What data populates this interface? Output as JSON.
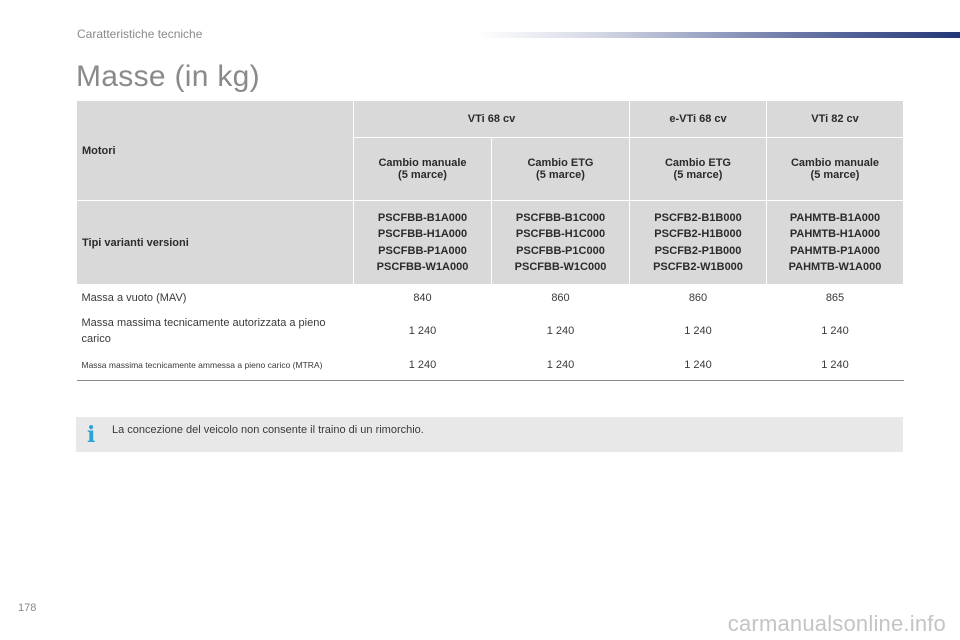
{
  "header": {
    "section": "Caratteristiche tecniche"
  },
  "title": "Masse (in kg)",
  "table": {
    "motori_label": "Motori",
    "engines": [
      "VTi 68 cv",
      "e-VTi 68 cv",
      "VTi 82 cv"
    ],
    "gearboxes": [
      [
        "Cambio manuale",
        "(5 marce)"
      ],
      [
        "Cambio ETG",
        "(5 marce)"
      ],
      [
        "Cambio ETG",
        "(5 marce)"
      ],
      [
        "Cambio manuale",
        "(5 marce)"
      ]
    ],
    "variants_label": "Tipi varianti versioni",
    "variants": [
      [
        "PSCFBB-B1A000",
        "PSCFBB-H1A000",
        "PSCFBB-P1A000",
        "PSCFBB-W1A000"
      ],
      [
        "PSCFBB-B1C000",
        "PSCFBB-H1C000",
        "PSCFBB-P1C000",
        "PSCFBB-W1C000"
      ],
      [
        "PSCFB2-B1B000",
        "PSCFB2-H1B000",
        "PSCFB2-P1B000",
        "PSCFB2-W1B000"
      ],
      [
        "PAHMTB-B1A000",
        "PAHMTB-H1A000",
        "PAHMTB-P1A000",
        "PAHMTB-W1A000"
      ]
    ],
    "rows": [
      {
        "label": "Massa a vuoto (MAV)",
        "values": [
          "840",
          "860",
          "860",
          "865"
        ]
      },
      {
        "label": "Massa massima tecnicamente autorizzata a pieno carico",
        "values": [
          "1 240",
          "1 240",
          "1 240",
          "1 240"
        ]
      },
      {
        "label": "Massa massima tecnicamente ammessa a pieno carico (MTRA)",
        "values": [
          "1 240",
          "1 240",
          "1 240",
          "1 240"
        ]
      }
    ]
  },
  "info": {
    "icon": "info-icon",
    "text": "La concezione del veicolo non consente il traino di un rimorchio."
  },
  "footer": {
    "page_number": "178",
    "watermark": "carmanualsonline.info"
  },
  "colors": {
    "header_fill": "#d9d9d9",
    "info_fill": "#e8e8e8",
    "info_icon": "#2aa3d8",
    "bar_dark": "#233777"
  }
}
